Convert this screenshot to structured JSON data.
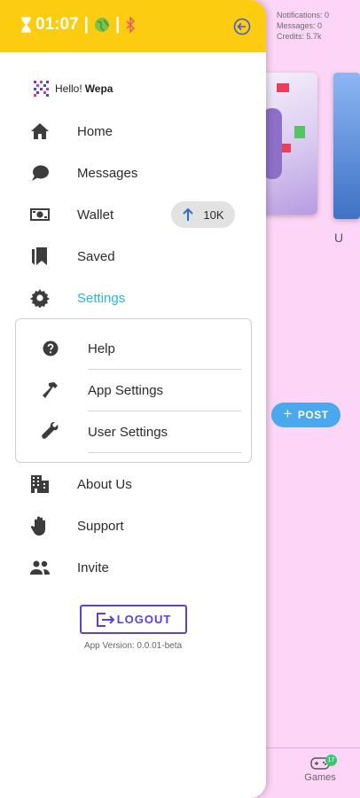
{
  "background": {
    "notifications": "Notifications: 0",
    "messages": "Messages: 0",
    "credits": "Credits: 5.7k",
    "card_label": "U",
    "post_label": "POST",
    "games_label": "Games",
    "games_badge": "17"
  },
  "header": {
    "time": "01:07",
    "separator": "|",
    "bg_color": "#fbcc0f"
  },
  "greeting": {
    "hello": "Hello!",
    "username": "Wepa"
  },
  "menu": [
    {
      "label": "Home",
      "icon": "home-icon"
    },
    {
      "label": "Messages",
      "icon": "chat-icon"
    },
    {
      "label": "Wallet",
      "icon": "money-icon"
    },
    {
      "label": "Saved",
      "icon": "bookmark-icon"
    },
    {
      "label": "Settings",
      "icon": "gear-icon",
      "active": true
    },
    {
      "label": "About Us",
      "icon": "building-icon"
    },
    {
      "label": "Support",
      "icon": "hand-icon"
    },
    {
      "label": "Invite",
      "icon": "people-icon"
    }
  ],
  "wallet_chip": {
    "value": "10K"
  },
  "settings_submenu": [
    {
      "label": "Help",
      "icon": "help-icon"
    },
    {
      "label": "App Settings",
      "icon": "hammer-icon"
    },
    {
      "label": "User Settings",
      "icon": "wrench-icon"
    }
  ],
  "logout": {
    "label": "LOGOUT"
  },
  "version": "App Version: 0.0.01-beta",
  "colors": {
    "accent": "#27b6e0",
    "logout": "#5b3fd6",
    "background": "#fdd6f7"
  }
}
